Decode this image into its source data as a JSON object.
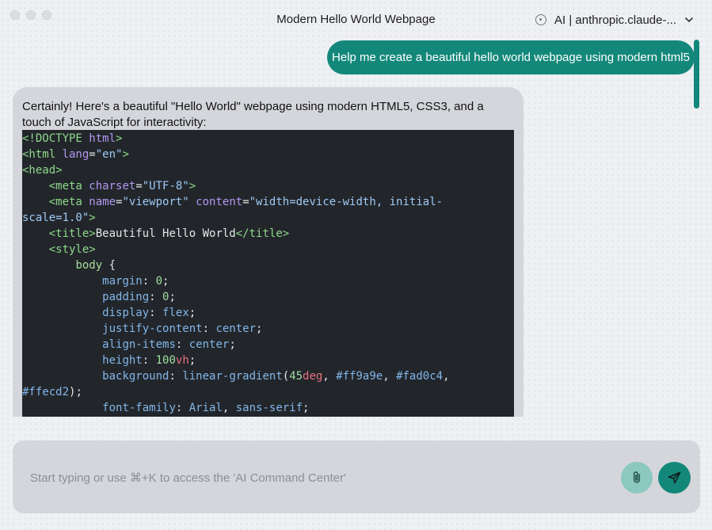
{
  "window": {
    "title": "Modern Hello World Webpage",
    "model_label": "AI | anthropic.claude-..."
  },
  "chat": {
    "user_message": "Help me create a beautiful hello world webpage using modern html5",
    "assistant_intro": "Certainly! Here's a beautiful \"Hello World\" webpage using modern HTML5, CSS3, and a touch of JavaScript for interactivity:",
    "code_lines": [
      [
        [
          "t",
          "<!DOCTYPE "
        ],
        [
          "a",
          "html"
        ],
        [
          "t",
          ">"
        ]
      ],
      [
        [
          "t",
          "<html "
        ],
        [
          "a",
          "lang"
        ],
        [
          "p",
          "="
        ],
        [
          "s",
          "\"en\""
        ],
        [
          "t",
          ">"
        ]
      ],
      [
        [
          "t",
          "<head>"
        ]
      ],
      [
        [
          "p",
          "    "
        ],
        [
          "t",
          "<meta "
        ],
        [
          "a",
          "charset"
        ],
        [
          "p",
          "="
        ],
        [
          "s",
          "\"UTF-8\""
        ],
        [
          "t",
          ">"
        ]
      ],
      [
        [
          "p",
          "    "
        ],
        [
          "t",
          "<meta "
        ],
        [
          "a",
          "name"
        ],
        [
          "p",
          "="
        ],
        [
          "s",
          "\"viewport\" "
        ],
        [
          "a",
          "content"
        ],
        [
          "p",
          "="
        ],
        [
          "s",
          "\"width=device-width, initial-"
        ]
      ],
      [
        [
          "s",
          "scale=1.0\""
        ],
        [
          "t",
          ">"
        ]
      ],
      [
        [
          "p",
          "    "
        ],
        [
          "t",
          "<title>"
        ],
        [
          "p",
          "Beautiful Hello World"
        ],
        [
          "t",
          "</title>"
        ]
      ],
      [
        [
          "p",
          "    "
        ],
        [
          "t",
          "<style>"
        ]
      ],
      [
        [
          "p",
          "        "
        ],
        [
          "sel",
          "body"
        ],
        [
          "p",
          " {"
        ]
      ],
      [
        [
          "p",
          "            "
        ],
        [
          "v",
          "margin"
        ],
        [
          "p",
          ": "
        ],
        [
          "n",
          "0"
        ],
        [
          "p",
          ";"
        ]
      ],
      [
        [
          "p",
          "            "
        ],
        [
          "v",
          "padding"
        ],
        [
          "p",
          ": "
        ],
        [
          "n",
          "0"
        ],
        [
          "p",
          ";"
        ]
      ],
      [
        [
          "p",
          "            "
        ],
        [
          "v",
          "display"
        ],
        [
          "p",
          ": "
        ],
        [
          "v",
          "flex"
        ],
        [
          "p",
          ";"
        ]
      ],
      [
        [
          "p",
          "            "
        ],
        [
          "v",
          "justify-content"
        ],
        [
          "p",
          ": "
        ],
        [
          "v",
          "center"
        ],
        [
          "p",
          ";"
        ]
      ],
      [
        [
          "p",
          "            "
        ],
        [
          "v",
          "align-items"
        ],
        [
          "p",
          ": "
        ],
        [
          "v",
          "center"
        ],
        [
          "p",
          ";"
        ]
      ],
      [
        [
          "p",
          "            "
        ],
        [
          "v",
          "height"
        ],
        [
          "p",
          ": "
        ],
        [
          "n",
          "100"
        ],
        [
          "u",
          "vh"
        ],
        [
          "p",
          ";"
        ]
      ],
      [
        [
          "p",
          "            "
        ],
        [
          "v",
          "background"
        ],
        [
          "p",
          ": "
        ],
        [
          "v",
          "linear-gradient"
        ],
        [
          "p",
          "("
        ],
        [
          "n",
          "45"
        ],
        [
          "u",
          "deg"
        ],
        [
          "p",
          ", "
        ],
        [
          "v",
          "#ff9a9e"
        ],
        [
          "p",
          ", "
        ],
        [
          "v",
          "#fad0c4"
        ],
        [
          "p",
          ","
        ]
      ],
      [
        [
          "v",
          "#ffecd2"
        ],
        [
          "p",
          ");"
        ]
      ],
      [
        [
          "p",
          "            "
        ],
        [
          "v",
          "font-family"
        ],
        [
          "p",
          ": "
        ],
        [
          "v",
          "Arial"
        ],
        [
          "p",
          ", "
        ],
        [
          "v",
          "sans-serif"
        ],
        [
          "p",
          ";"
        ]
      ]
    ]
  },
  "input": {
    "placeholder": "Start typing or use ⌘+K to access the 'AI Command Center'"
  },
  "icons": {
    "model": "model-status-icon",
    "dropdown": "chevron-down-icon",
    "attach": "paperclip-icon",
    "send": "send-icon"
  },
  "colors": {
    "accent": "#13887a",
    "accent_light": "#8cc8bf",
    "code_bg": "#22262b",
    "bubble_bg": "#d4d6db"
  }
}
